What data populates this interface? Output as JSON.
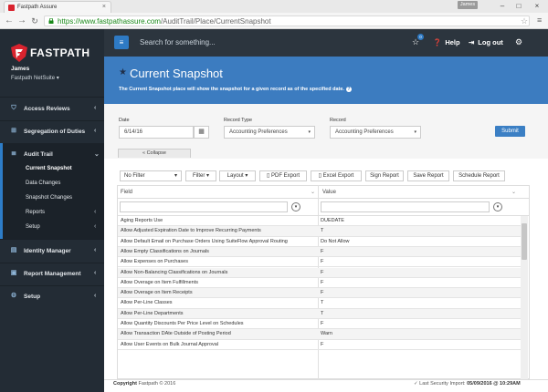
{
  "browser": {
    "tab_title": "Fastpath Assure",
    "user_chip": "James",
    "url_host": "https://www.fastpathassure.com",
    "url_path": "/AuditTrail/Place/CurrentSnapshot"
  },
  "sidebar": {
    "logo_text": "FASTPATH",
    "user_name": "James",
    "user_org": "Fastpath NetSuite ▾",
    "items": [
      {
        "label": "Access Reviews",
        "icon": "shield-icon"
      },
      {
        "label": "Segregation of Duties",
        "icon": "sitemap-icon"
      },
      {
        "label": "Audit Trail",
        "icon": "list-icon"
      },
      {
        "label": "Identity Manager",
        "icon": "id-card-icon"
      },
      {
        "label": "Report Management",
        "icon": "briefcase-icon"
      },
      {
        "label": "Setup",
        "icon": "gear-icon"
      }
    ],
    "sub_items": [
      {
        "label": "Current Snapshot",
        "active": true
      },
      {
        "label": "Data Changes"
      },
      {
        "label": "Snapshot Changes"
      },
      {
        "label": "Reports"
      },
      {
        "label": "Setup"
      }
    ]
  },
  "topnav": {
    "search_placeholder": "Search for something...",
    "notification_count": "0",
    "help_label": "Help",
    "logout_label": "Log out"
  },
  "header": {
    "title": "Current Snapshot",
    "description": "The Current Snapshot place will show the snapshot for a given record as of the specified date."
  },
  "form": {
    "date_label": "Date",
    "date_value": "6/14/16",
    "record_type_label": "Record Type",
    "record_type_value": "Accounting Preferences",
    "record_label": "Record",
    "record_value": "Accounting Preferences",
    "submit_label": "Submit",
    "collapse_label": "« Collapse"
  },
  "toolbar": {
    "filter_select": "No Filter",
    "filter": "Filter",
    "layout": "Layout",
    "pdf_export": "PDF Export",
    "excel_export": "Excel Export",
    "sign_report": "Sign Report",
    "save_report": "Save Report",
    "schedule_report": "Schedule Report"
  },
  "grid": {
    "columns": [
      "Field",
      "Value"
    ],
    "rows": [
      [
        "Aging Reports Use",
        "DUEDATE"
      ],
      [
        "Allow Adjusted Expiration Date to Improve Recurring Payments",
        "T"
      ],
      [
        "Allow Default Email on Purchase Orders Using SuiteFlow Approval Routing",
        "Do Not Allow"
      ],
      [
        "Allow Empty Classifications on Journals",
        "F"
      ],
      [
        "Allow Expenses on Purchases",
        "F"
      ],
      [
        "Allow Non-Balancing Classifications on Journals",
        "F"
      ],
      [
        "Allow Overage on Item Fulfillments",
        "F"
      ],
      [
        "Allow Overage on Item Receipts",
        "F"
      ],
      [
        "Allow Per-Line Classes",
        "T"
      ],
      [
        "Allow Per-Line Departments",
        "T"
      ],
      [
        "Allow Quantity Discounts Per Price Level on Schedules",
        "F"
      ],
      [
        "Allow Transaction DAte Outside of Posting Period",
        "Warn"
      ],
      [
        "Allow User Events on Bulk Journal Approval",
        "F"
      ]
    ]
  },
  "footer": {
    "copyright_label": "Copyright",
    "copyright_text": "Fastpath © 2016",
    "last_import_label": "Last Security Import:",
    "last_import_value": "05/09/2016 @ 10:29AM"
  },
  "colors": {
    "sidebar": "#232c35",
    "topnav": "#2c353e",
    "header": "#3c7cc0",
    "accent": "#2e7ac4"
  }
}
